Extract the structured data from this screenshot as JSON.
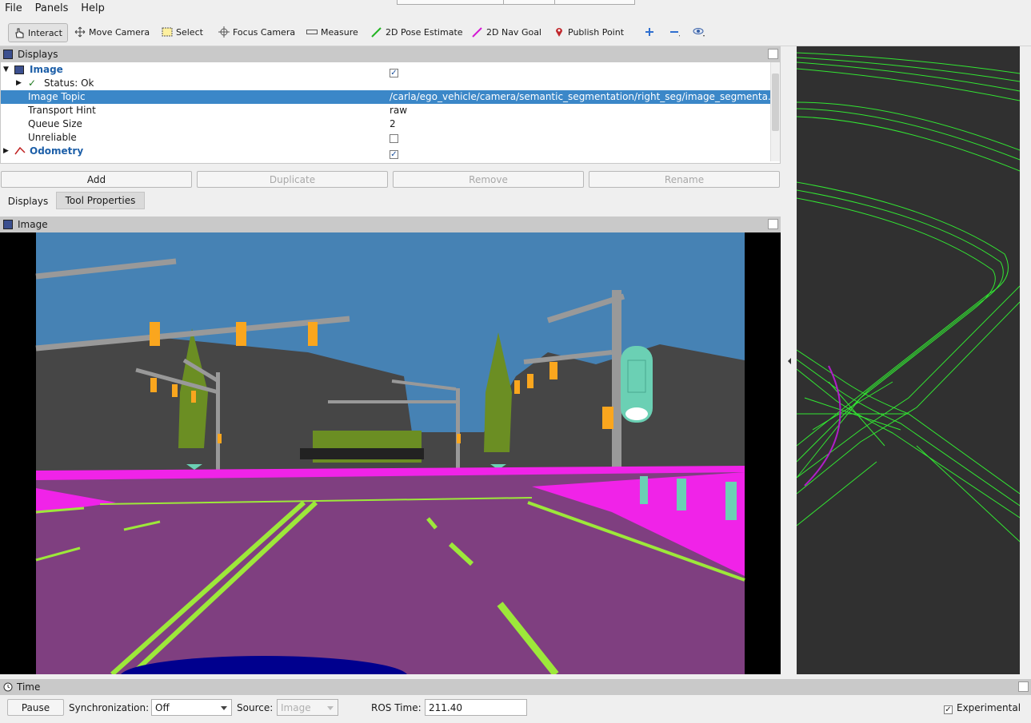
{
  "menubar": {
    "items": [
      "File",
      "Panels",
      "Help"
    ]
  },
  "toolbar": {
    "interact": "Interact",
    "move_camera": "Move Camera",
    "select": "Select",
    "focus_camera": "Focus Camera",
    "measure": "Measure",
    "pose_estimate": "2D Pose Estimate",
    "nav_goal": "2D Nav Goal",
    "publish_point": "Publish Point"
  },
  "displays": {
    "title": "Displays",
    "rows": [
      {
        "label": "Image",
        "value": "",
        "checked": true
      },
      {
        "label": "Status: Ok",
        "value": ""
      },
      {
        "label": "Image Topic",
        "value": "/carla/ego_vehicle/camera/semantic_segmentation/right_seg/image_segmenta..."
      },
      {
        "label": "Transport Hint",
        "value": "raw"
      },
      {
        "label": "Queue Size",
        "value": "2"
      },
      {
        "label": "Unreliable",
        "value": "",
        "checked": false
      },
      {
        "label": "Odometry",
        "value": "",
        "checked": true
      }
    ],
    "buttons": {
      "add": "Add",
      "duplicate": "Duplicate",
      "remove": "Remove",
      "rename": "Rename"
    },
    "tabs": {
      "displays": "Displays",
      "tool_properties": "Tool Properties"
    }
  },
  "image_panel": {
    "title": "Image"
  },
  "time_panel": {
    "title": "Time",
    "pause": "Pause",
    "sync_label": "Synchronization:",
    "sync_value": "Off",
    "source_label": "Source:",
    "source_value": "Image",
    "ros_time_label": "ROS Time:",
    "ros_time_value": "211.40",
    "experimental": "Experimental"
  },
  "colors": {
    "selection": "#3b87c8",
    "sky": "#4682b4",
    "road": "#7f3f80",
    "sidewalk": "#f023e8",
    "building": "#464646",
    "vegetation": "#6b8e23",
    "lane_marking": "#9de83a",
    "pole": "#999999",
    "traffic_light": "#faa61e",
    "map_lines": "#32e632"
  }
}
